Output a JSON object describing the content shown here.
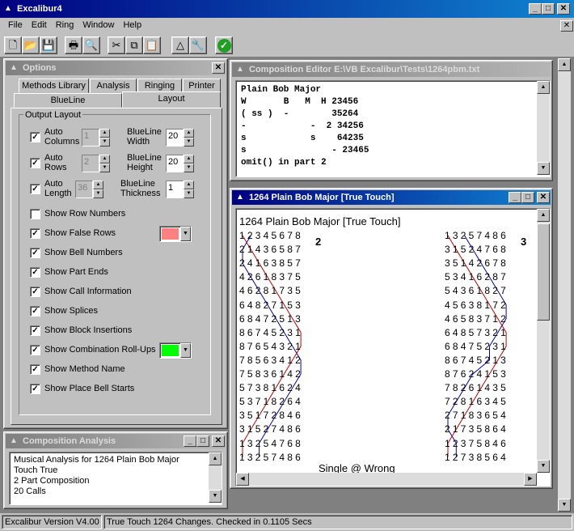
{
  "app": {
    "title": "Excalibur4",
    "version_status": "Excalibur Version V4.00",
    "touch_status": "True Touch 1264 Changes. Checked in 0.1105 Secs"
  },
  "menu": [
    "File",
    "Edit",
    "Ring",
    "Window",
    "Help"
  ],
  "toolbar": [
    "new-icon",
    "open-icon",
    "save-icon",
    "print-icon",
    "print-preview-icon",
    "cut-icon",
    "copy-icon",
    "paste-icon",
    "bell-icon",
    "tools-icon",
    "check-icon"
  ],
  "options": {
    "title": "Options",
    "tabs_row1": [
      "Methods Library",
      "Analysis",
      "Ringing",
      "Printer"
    ],
    "tabs_row2": [
      "BlueLine",
      "Layout"
    ],
    "group": "Output Layout",
    "auto_columns": "Auto Columns",
    "auto_columns_value": "1",
    "blueline_width": "BlueLine Width",
    "blueline_width_value": "20",
    "auto_rows": "Auto Rows",
    "auto_rows_value": "2",
    "blueline_height": "BlueLine Height",
    "blueline_height_value": "20",
    "auto_length": "Auto Length",
    "auto_length_value": "36",
    "blueline_thickness": "BlueLine Thickness",
    "blueline_thickness_value": "1",
    "checks": [
      {
        "label": "Show Row Numbers",
        "checked": false
      },
      {
        "label": "Show False Rows",
        "checked": true,
        "color": "#ff8080"
      },
      {
        "label": "Show Bell Numbers",
        "checked": true
      },
      {
        "label": "Show Part Ends",
        "checked": true
      },
      {
        "label": "Show Call Information",
        "checked": true
      },
      {
        "label": "Show Splices",
        "checked": true
      },
      {
        "label": "Show Block Insertions",
        "checked": true
      },
      {
        "label": "Show Combination Roll-Ups",
        "checked": true,
        "color": "#00ff00"
      },
      {
        "label": "Show Method Name",
        "checked": true
      },
      {
        "label": "Show Place Bell Starts",
        "checked": true
      }
    ]
  },
  "analysis": {
    "title": "Composition Analysis",
    "lines": [
      "Musical Analysis for 1264 Plain Bob Major",
      "Touch True",
      "2 Part Composition",
      "20 Calls"
    ]
  },
  "editor": {
    "title": "Composition Editor E:\\VB Excalibur\\Tests\\1264pbm.txt",
    "lines": [
      "Plain Bob Major",
      "W       B   M  H 23456",
      "( ss )  -        35264",
      "-            -  2 34256",
      "s            s    64235",
      "s                - 23465",
      "omit() in part 2"
    ]
  },
  "touch": {
    "title": "1264 Plain Bob Major [True Touch]",
    "heading": "1264 Plain Bob Major [True Touch]",
    "col1": [
      "12345678",
      "21436587",
      "24163857",
      "42618375",
      "46281735",
      "64827153",
      "68472513",
      "86745231",
      "87654321",
      "78563412",
      "75836142",
      "57381624",
      "53718264",
      "35172846",
      "31527486",
      "13254768",
      "13257486"
    ],
    "col1_label1": "2",
    "col1_note": "Single @ Wrong",
    "col2": [
      "13257486",
      "31524768",
      "35142678",
      "53416287",
      "54361827",
      "45638172",
      "46583712",
      "64857321",
      "68475231",
      "86745213",
      "87624153",
      "78261435",
      "72816345",
      "27183654",
      "21735864",
      "12375846",
      "12738564"
    ],
    "col2_label1": "3"
  }
}
